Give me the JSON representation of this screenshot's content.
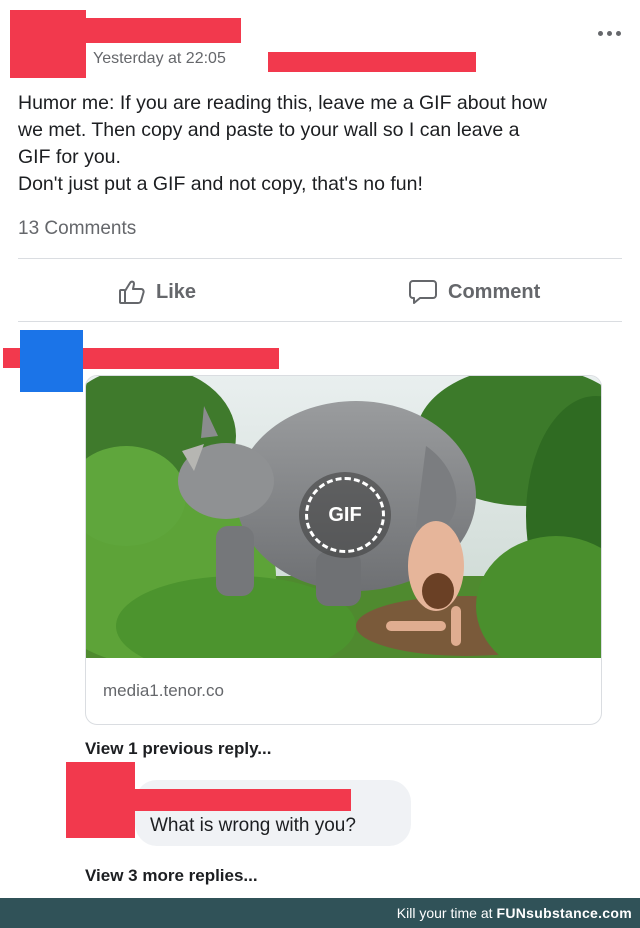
{
  "post": {
    "timestamp": "Yesterday at 22:05",
    "text_lines": [
      "Humor me: If you are reading this, leave me a GIF about how",
      "we met. Then copy and paste to your wall so I can leave a",
      "GIF for you.",
      "Don't just put a GIF and not copy, that's no fun!"
    ],
    "comments_count": "13 Comments"
  },
  "actions": {
    "like_label": "Like",
    "comment_label": "Comment"
  },
  "comment": {
    "gif_badge": "GIF",
    "gif_source": "media1.tenor.co",
    "view_previous": "View 1 previous reply...",
    "reply_text": "What is wrong with you?",
    "view_more": "View 3 more replies..."
  },
  "footer": {
    "tagline": "Kill your time at",
    "brand": "FUNsubstance.com"
  },
  "icons": {
    "more": "more-dots-icon",
    "like": "thumbs-up-icon",
    "comment": "speech-bubble-icon",
    "gif": "gif-badge-icon"
  },
  "colors": {
    "redaction": "#f2394d",
    "avatar_blue": "#1b74e8",
    "footer_bg": "#305258"
  }
}
